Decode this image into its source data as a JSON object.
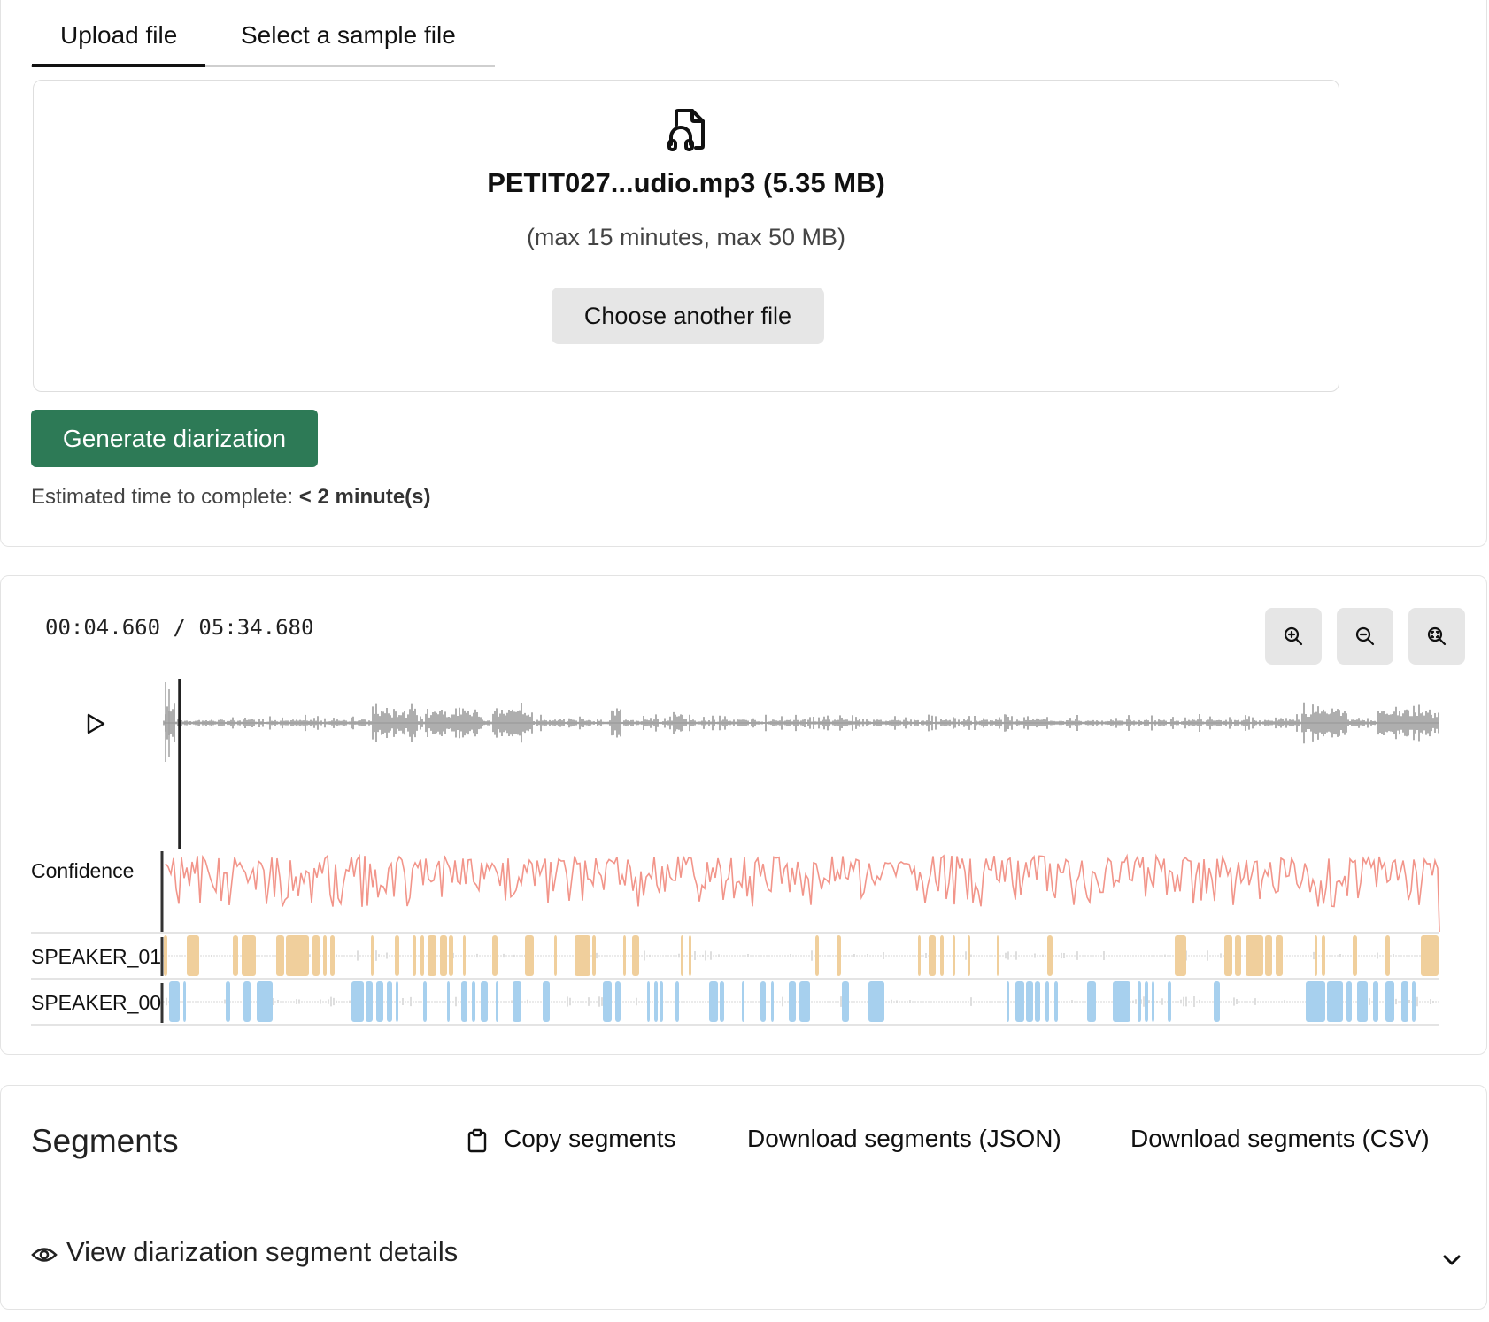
{
  "tabs": [
    {
      "label": "Upload file",
      "active": true
    },
    {
      "label": "Select a sample file",
      "active": false
    }
  ],
  "upload": {
    "file_icon": "audio-file-icon",
    "file_name": "PETIT027...udio.mp3 (5.35 MB)",
    "limits": "(max 15 minutes, max 50 MB)",
    "choose_label": "Choose another file"
  },
  "generate": {
    "label": "Generate diarization",
    "estimate_prefix": "Estimated time to complete:",
    "estimate_value": "< 2 minute(s)"
  },
  "player": {
    "time": "00:04.660 / 05:34.680",
    "zoom_in_icon": "zoom-in-icon",
    "zoom_out_icon": "zoom-out-icon",
    "zoom_fit_icon": "zoom-fit-icon",
    "play_icon": "play-icon",
    "tracks": [
      {
        "label": "Confidence",
        "color": "#f2958a"
      },
      {
        "label": "SPEAKER_01",
        "color": "#f0cf9c"
      },
      {
        "label": "SPEAKER_00",
        "color": "#a7d0ee"
      }
    ]
  },
  "segments": {
    "title": "Segments",
    "copy_label": "Copy segments",
    "copy_icon": "clipboard-icon",
    "download_json_label": "Download segments (JSON)",
    "download_csv_label": "Download segments (CSV)",
    "details_label": "View diarization segment details",
    "details_icon": "eye-icon",
    "expand_icon": "chevron-down-icon"
  },
  "colors": {
    "accent_green": "#2d7a56",
    "waveform": "#9a9a9a",
    "confidence": "#f2958a",
    "speaker_01": "#f0cf9c",
    "speaker_00": "#a7d0ee"
  }
}
